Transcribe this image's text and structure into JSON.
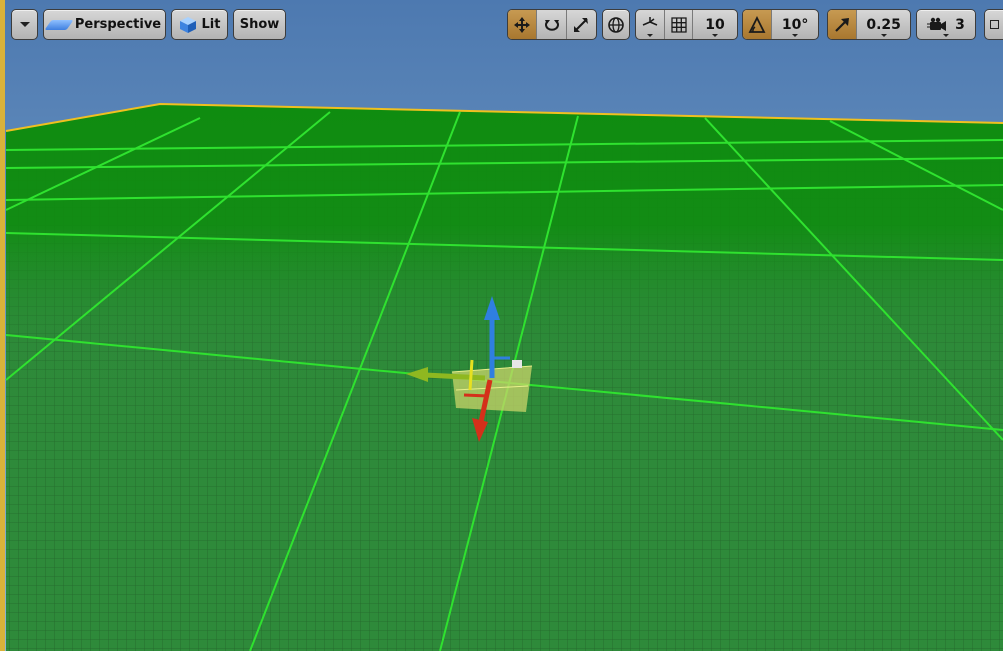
{
  "toolbar": {
    "view_mode_label": "Perspective",
    "lighting_label": "Lit",
    "show_label": "Show",
    "grid_snap_value": "10",
    "rotation_snap_value": "10°",
    "scale_snap_value": "0.25",
    "camera_speed_value": "3"
  },
  "icons": {
    "viewport_options": "chevron-down-icon",
    "perspective": "perspective-icon",
    "lit": "lit-cube-icon",
    "translate": "translate-icon",
    "rotate": "rotate-icon",
    "scale": "scale-icon",
    "world_local": "globe-icon",
    "surface_snap": "surface-snap-icon",
    "grid_snap": "grid-icon",
    "rotation_snap": "rotation-snap-icon",
    "scale_snap": "scale-snap-icon",
    "camera_speed": "camera-icon",
    "maximize": "maximize-icon"
  },
  "colors": {
    "sky": "#6f9cc6",
    "ground": "#0c8c0c",
    "grid_major": "#2fe22f",
    "active_toggle": "#b8883f",
    "gizmo_x": "#d4301a",
    "gizmo_y": "#8fb820",
    "gizmo_z": "#2f7fe0",
    "selection_outline": "#f0c020"
  }
}
